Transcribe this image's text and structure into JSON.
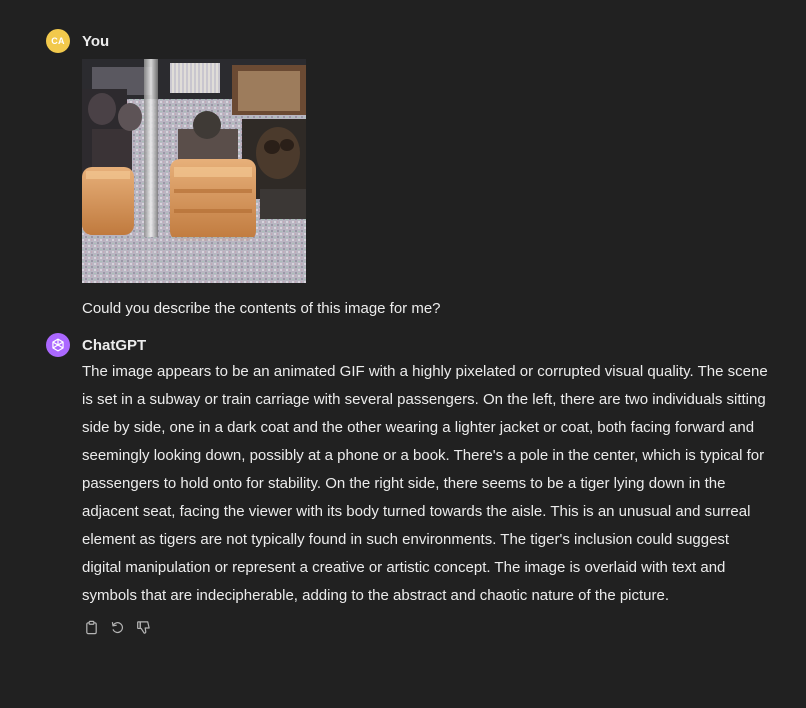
{
  "conversation": {
    "user": {
      "avatar_initials": "CA",
      "name": "You",
      "message": "Could you describe the contents of this image for me?"
    },
    "assistant": {
      "name": "ChatGPT",
      "message": "The image appears to be an animated GIF with a highly pixelated or corrupted visual quality. The scene is set in a subway or train carriage with several passengers. On the left, there are two individuals sitting side by side, one in a dark coat and the other wearing a lighter jacket or coat, both facing forward and seemingly looking down, possibly at a phone or a book. There's a pole in the center, which is typical for passengers to hold onto for stability. On the right side, there seems to be a tiger lying down in the adjacent seat, facing the viewer with its body turned towards the aisle. This is an unusual and surreal element as tigers are not typically found in such environments. The tiger's inclusion could suggest digital manipulation or represent a creative or artistic concept. The image is overlaid with text and symbols that are indecipherable, adding to the abstract and chaotic nature of the picture.",
      "actions": [
        {
          "icon": "clipboard-icon"
        },
        {
          "icon": "regenerate-icon"
        },
        {
          "icon": "thumbs-down-icon"
        }
      ]
    }
  },
  "colors": {
    "background": "#212121",
    "text": "#ececec",
    "user_avatar": "#f2c94c",
    "assistant_avatar": "#ab68ff",
    "icon": "#b4b4b4"
  }
}
